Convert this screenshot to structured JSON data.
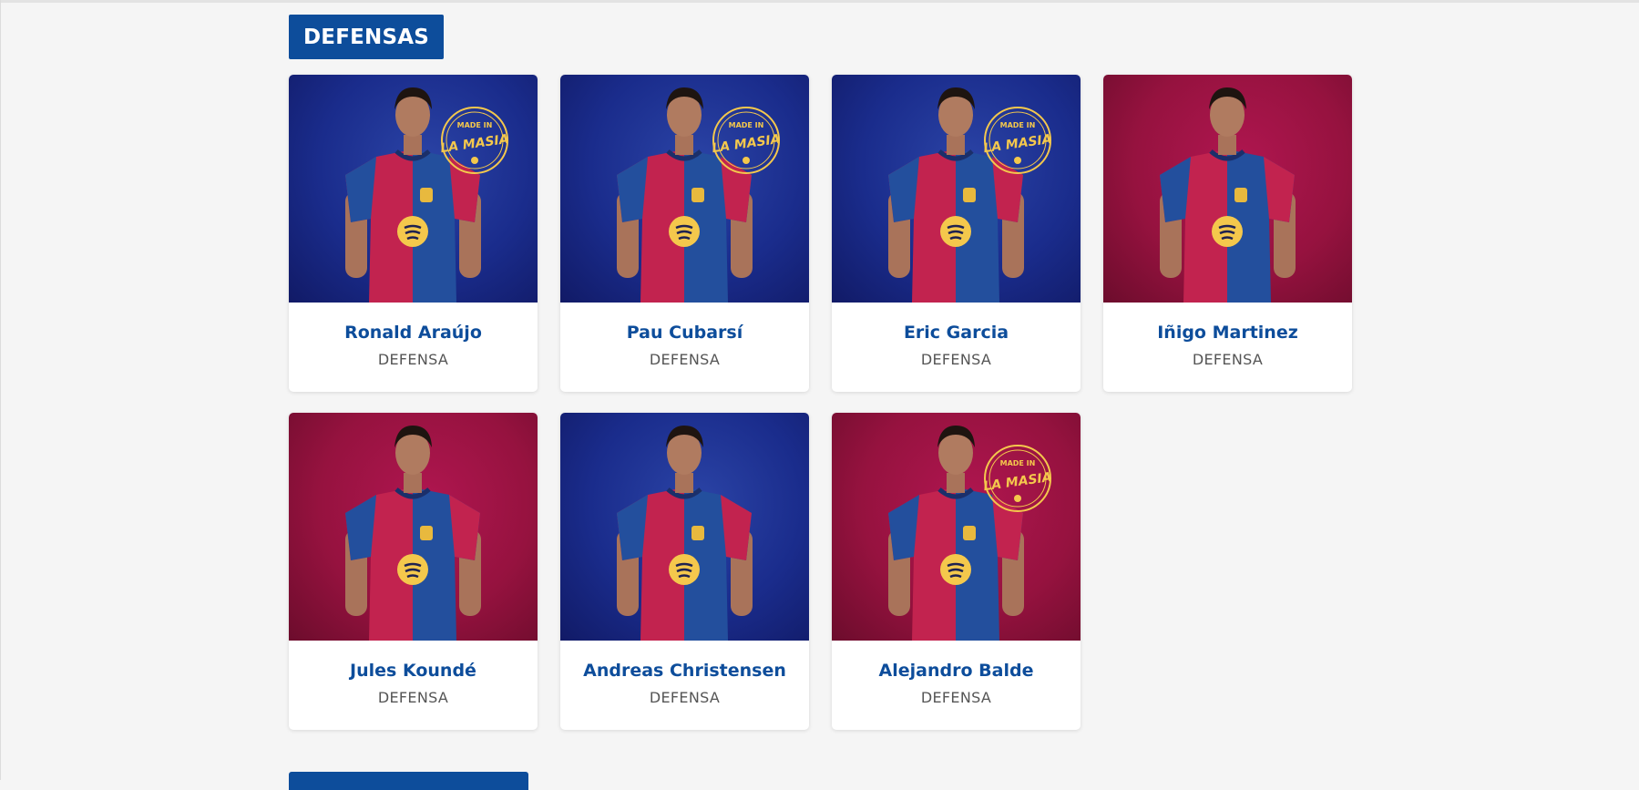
{
  "section": {
    "title": "DEFENSAS"
  },
  "badge_text": [
    "MADE IN",
    "LA MASIA"
  ],
  "colors": {
    "header_bg": "#0d4d9b",
    "name_text": "#0d4d9b",
    "position_text": "#555555",
    "bg_blue": "#1a2c8c",
    "bg_red": "#96123f",
    "badge_gold": "#f4c84c"
  },
  "players": [
    {
      "name": "Ronald Araújo",
      "position": "DEFENSA",
      "background": "blue",
      "la_masia": true
    },
    {
      "name": "Pau Cubarsí",
      "position": "DEFENSA",
      "background": "blue",
      "la_masia": true
    },
    {
      "name": "Eric Garcia",
      "position": "DEFENSA",
      "background": "blue",
      "la_masia": true
    },
    {
      "name": "Iñigo Martinez",
      "position": "DEFENSA",
      "background": "red",
      "la_masia": false
    },
    {
      "name": "Jules Koundé",
      "position": "DEFENSA",
      "background": "red",
      "la_masia": false
    },
    {
      "name": "Andreas Christensen",
      "position": "DEFENSA",
      "background": "blue",
      "la_masia": false
    },
    {
      "name": "Alejandro Balde",
      "position": "DEFENSA",
      "background": "red",
      "la_masia": true
    }
  ]
}
